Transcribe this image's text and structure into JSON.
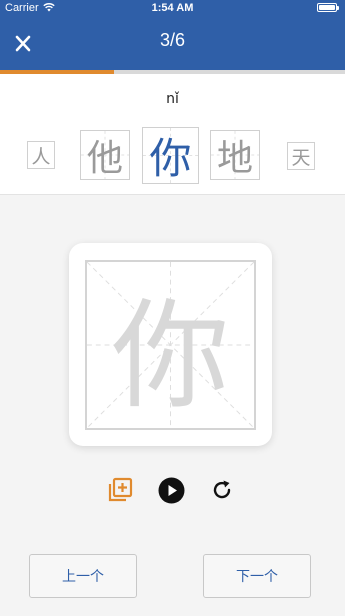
{
  "status_bar": {
    "carrier": "Carrier",
    "time": "1:54 AM"
  },
  "nav": {
    "close_icon": "close-icon",
    "title": "3/6"
  },
  "progress": {
    "fraction": 0.33,
    "color": "#e08a2e"
  },
  "current": {
    "pinyin": "nǐ",
    "character": "你"
  },
  "characters": [
    "人",
    "他",
    "你",
    "地",
    "天"
  ],
  "controls": {
    "add_icon": "add-to-list-icon",
    "play_icon": "play-icon",
    "replay_icon": "replay-icon",
    "accent_color": "#e08a2e"
  },
  "buttons": {
    "prev": "上一个",
    "next": "下一个"
  },
  "colors": {
    "primary": "#2f5fa8",
    "current_char": "#2f5fa8",
    "inactive_char": "#9a9a9a"
  }
}
